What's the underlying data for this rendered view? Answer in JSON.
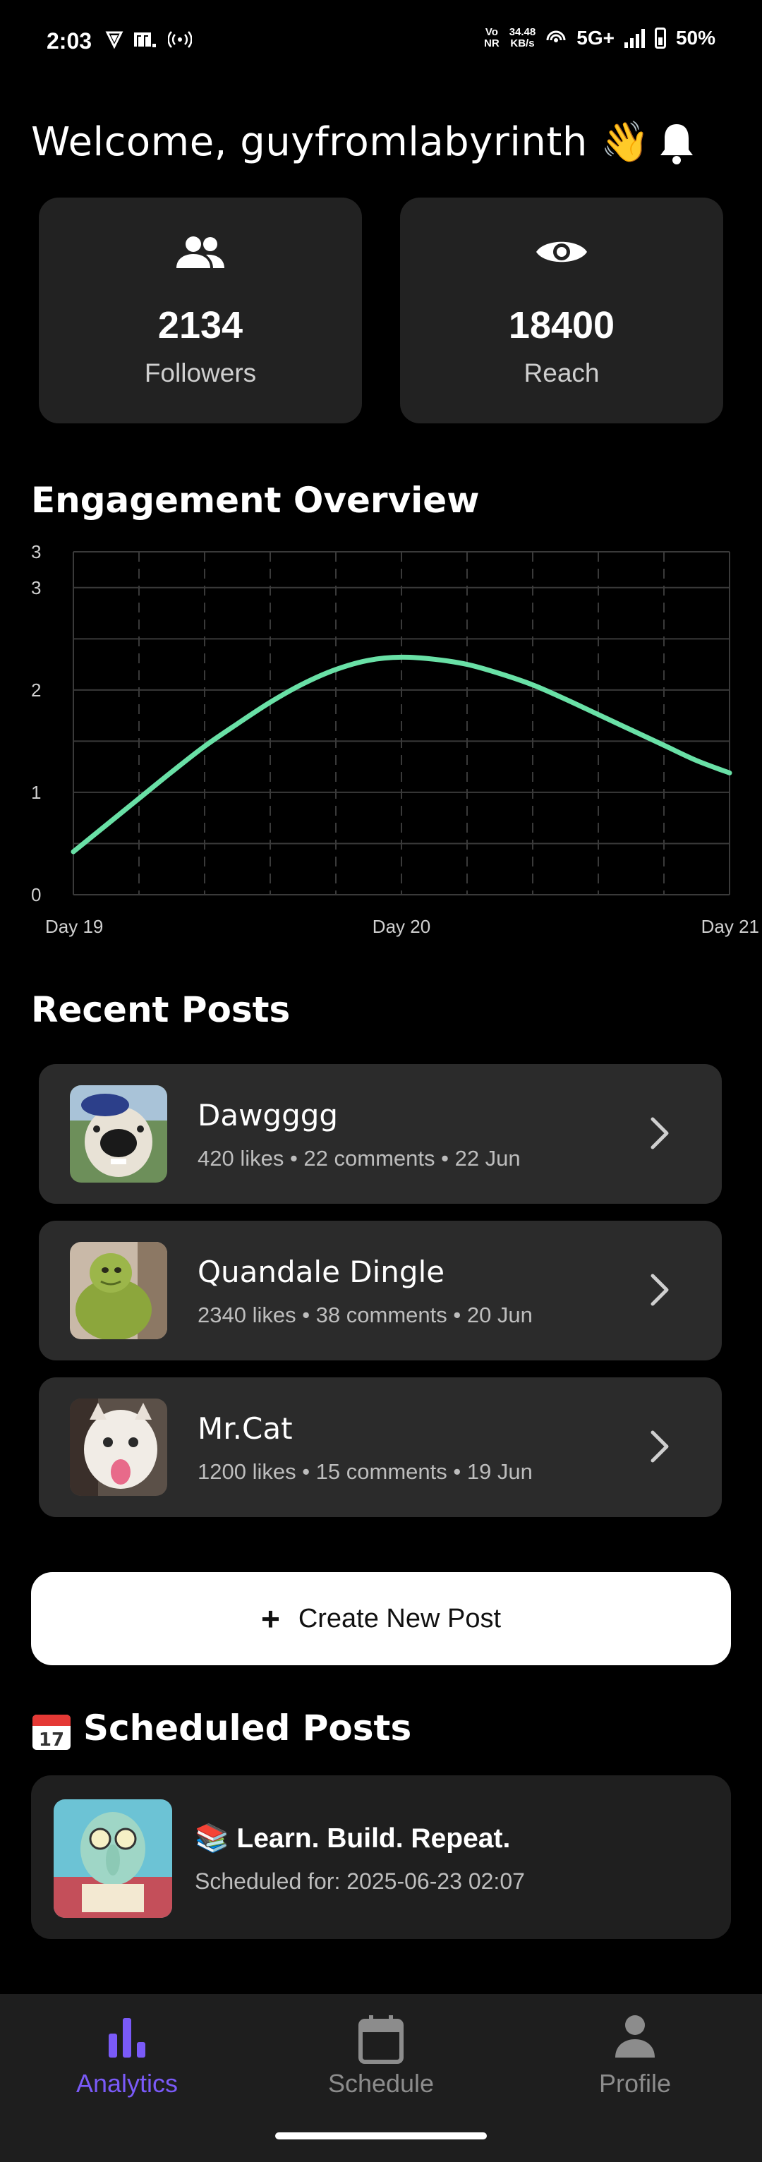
{
  "status_bar": {
    "time": "2:03",
    "network_type_top": "Vo",
    "network_type_bottom": "NR",
    "speed_value": "34.48",
    "speed_unit": "KB/s",
    "network": "5G+",
    "battery": "50%"
  },
  "header": {
    "welcome": "Welcome, guyfromlabyrinth 👋"
  },
  "stats": [
    {
      "value": "2134",
      "label": "Followers",
      "icon": "people-icon"
    },
    {
      "value": "18400",
      "label": "Reach",
      "icon": "eye-icon"
    }
  ],
  "engagement": {
    "title": "Engagement Overview"
  },
  "chart_data": {
    "type": "line",
    "x": [
      0,
      0.1,
      0.2,
      0.3,
      0.4,
      0.5,
      0.6,
      0.7,
      0.8,
      0.9,
      1.0,
      1.1,
      1.2,
      1.3,
      1.4,
      1.5,
      1.6,
      1.7,
      1.8,
      1.9,
      2.0
    ],
    "series": [
      {
        "values": [
          0.42,
          0.68,
          0.94,
          1.2,
          1.45,
          1.67,
          1.88,
          2.06,
          2.2,
          2.29,
          2.32,
          2.3,
          2.25,
          2.16,
          2.05,
          1.91,
          1.76,
          1.61,
          1.46,
          1.31,
          1.19
        ],
        "color": "#69E0A6"
      }
    ],
    "x_tick_values": [
      0,
      1,
      2
    ],
    "x_tick_labels": [
      "Day 19",
      "Day 20",
      "Day 21"
    ],
    "y_tick_values": [
      0,
      1,
      2,
      3,
      3.35
    ],
    "y_tick_labels": [
      "0",
      "1",
      "2",
      "3",
      "3"
    ],
    "xlim": [
      0,
      2
    ],
    "ylim": [
      0,
      3.35
    ],
    "grid": true,
    "title": "",
    "xlabel": "",
    "ylabel": ""
  },
  "recent": {
    "title": "Recent Posts",
    "posts": [
      {
        "title": "Dawgggg",
        "meta": "420 likes • 22 comments • 22 Jun"
      },
      {
        "title": "Quandale Dingle",
        "meta": "2340 likes • 38 comments • 20 Jun"
      },
      {
        "title": "Mr.Cat",
        "meta": "1200 likes • 15 comments • 19 Jun"
      }
    ]
  },
  "create": {
    "label": "Create New Post"
  },
  "scheduled": {
    "title": "Scheduled Posts",
    "post_title": "📚 Learn. Build. Repeat.",
    "post_sub": "Scheduled for: 2025-06-23 02:07"
  },
  "nav": {
    "items": [
      {
        "label": "Analytics",
        "icon": "bar-chart-icon"
      },
      {
        "label": "Schedule",
        "icon": "calendar-icon"
      },
      {
        "label": "Profile",
        "icon": "person-icon"
      }
    ]
  },
  "colors": {
    "accent": "#7a5af8",
    "line": "#69E0A6",
    "card": "#222222",
    "post_card": "#2b2b2b"
  }
}
